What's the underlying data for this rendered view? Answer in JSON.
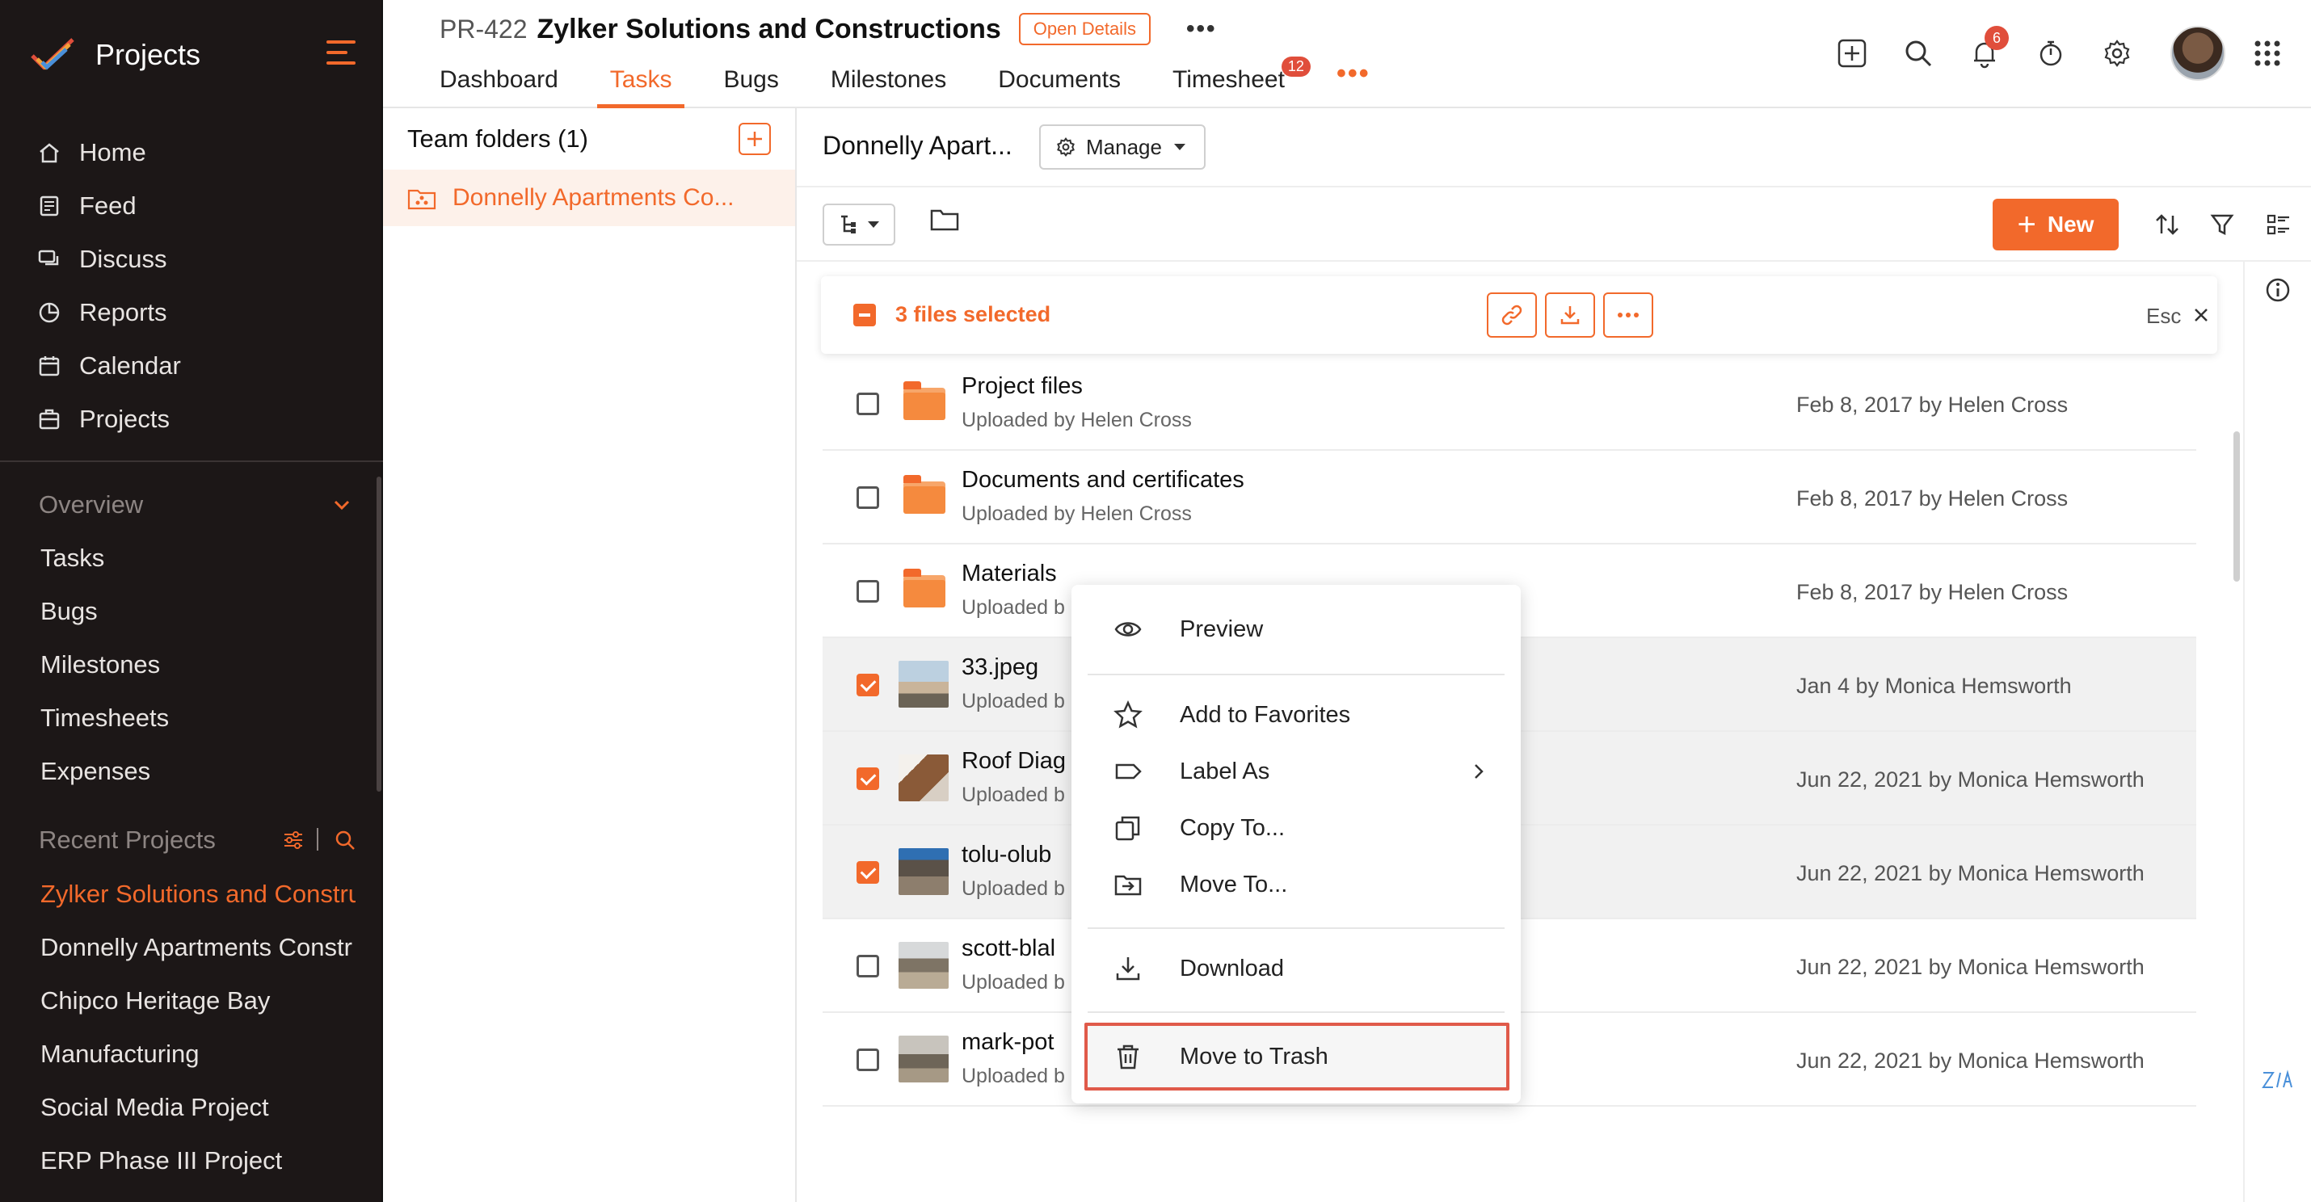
{
  "sidebar": {
    "brand": "Projects",
    "nav": [
      {
        "label": "Home",
        "icon": "home-icon"
      },
      {
        "label": "Feed",
        "icon": "feed-icon"
      },
      {
        "label": "Discuss",
        "icon": "discuss-icon"
      },
      {
        "label": "Reports",
        "icon": "reports-icon"
      },
      {
        "label": "Calendar",
        "icon": "calendar-icon"
      },
      {
        "label": "Projects",
        "icon": "projects-icon"
      }
    ],
    "overview_label": "Overview",
    "overview_items": [
      "Tasks",
      "Bugs",
      "Milestones",
      "Timesheets",
      "Expenses"
    ],
    "recent_label": "Recent Projects",
    "recent_items": [
      "Zylker Solutions and Constru",
      "Donnelly Apartments Constr",
      "Chipco Heritage Bay",
      "Manufacturing",
      "Social Media Project",
      "ERP Phase III Project"
    ]
  },
  "header": {
    "project_id": "PR-422",
    "project_name": "Zylker Solutions and Constructions",
    "open_details": "Open Details",
    "more": "•••",
    "tabs": [
      {
        "label": "Dashboard"
      },
      {
        "label": "Tasks"
      },
      {
        "label": "Bugs"
      },
      {
        "label": "Milestones"
      },
      {
        "label": "Documents"
      },
      {
        "label": "Timesheet",
        "badge": "12"
      }
    ],
    "tabs_more": "•••",
    "notification_count": "6"
  },
  "folders": {
    "title": "Team folders (1)",
    "active_folder": "Donnelly Apartments Co..."
  },
  "main": {
    "breadcrumb": "Donnelly Apart...",
    "manage_label": "Manage",
    "new_label": "New",
    "selection": {
      "text": "3 files selected",
      "esc_label": "Esc"
    },
    "files": [
      {
        "name": "Project files",
        "meta": "Uploaded by Helen Cross",
        "date": "Feb 8, 2017 by Helen Cross",
        "type": "folder",
        "selected": false
      },
      {
        "name": "Documents and certificates",
        "meta": "Uploaded by Helen Cross",
        "date": "Feb 8, 2017 by Helen Cross",
        "type": "folder",
        "selected": false
      },
      {
        "name": "Materials",
        "meta": "Uploaded b",
        "date": "Feb 8, 2017 by Helen Cross",
        "type": "folder",
        "selected": false
      },
      {
        "name": "33.jpeg",
        "meta": "Uploaded b",
        "date": "Jan 4 by Monica Hemsworth",
        "type": "image",
        "selected": true
      },
      {
        "name": "Roof Diag",
        "meta": "Uploaded b",
        "date": "Jun 22, 2021 by Monica Hemsworth",
        "type": "image",
        "selected": true
      },
      {
        "name": "tolu-olub",
        "meta": "Uploaded b",
        "date": "Jun 22, 2021 by Monica Hemsworth",
        "type": "image",
        "selected": true
      },
      {
        "name": "scott-blal",
        "meta": "Uploaded b",
        "date": "Jun 22, 2021 by Monica Hemsworth",
        "type": "image",
        "selected": false
      },
      {
        "name": "mark-pot",
        "meta": "Uploaded b",
        "date": "Jun 22, 2021 by Monica Hemsworth",
        "type": "image",
        "selected": false
      }
    ]
  },
  "context_menu": {
    "preview": "Preview",
    "favorites": "Add to Favorites",
    "label_as": "Label As",
    "copy_to": "Copy To...",
    "move_to": "Move To...",
    "download": "Download",
    "trash": "Move to Trash"
  },
  "colors": {
    "accent": "#f2692b",
    "sidebar_bg": "#1c1717",
    "highlight_border": "#e05a4a"
  }
}
